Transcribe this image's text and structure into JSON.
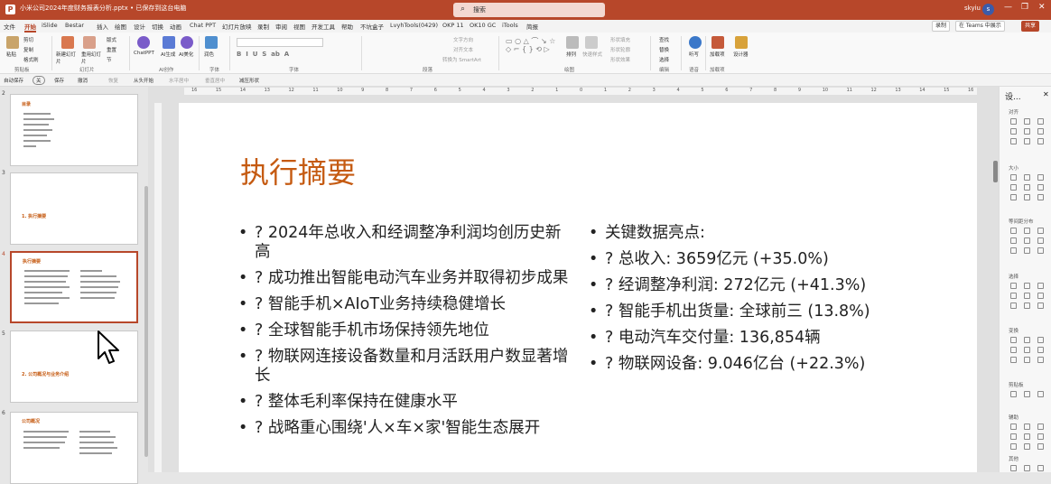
{
  "window": {
    "document_title": "小米公司2024年度财务报表分析.pptx • 已保存到这台电脑",
    "app_icon": "P",
    "search_placeholder": "搜索",
    "user_name": "skyiu",
    "avatar_letter": "s",
    "controls": [
      "—",
      "❐",
      "✕"
    ]
  },
  "tabs": {
    "items": [
      "文件",
      "开始",
      "iSlide",
      "Bestar",
      "插入",
      "绘图",
      "设计",
      "切换",
      "动画",
      "Chat PPT",
      "幻灯片放映",
      "录制",
      "审阅",
      "视图",
      "开发工具",
      "帮助",
      "不坑盒子",
      "LvyhTools(0429)",
      "OKP 11",
      "OK10 GC",
      "iTools",
      "简报"
    ],
    "active_index": 1,
    "record_label": "录制",
    "teams_label": "在 Teams 中展示",
    "share_label": "共享"
  },
  "ribbon": {
    "groups": [
      "剪贴板",
      "幻灯片",
      "AI创作",
      "字体",
      "段落",
      "绘图",
      "编辑",
      "语音",
      "加载项"
    ],
    "buttons": [
      "粘贴",
      "新建幻灯片",
      "重用幻灯片",
      "ChatPPT",
      "AI生成",
      "AI美化",
      "润色"
    ],
    "small_buttons": [
      "剪切",
      "复制",
      "格式刷",
      "版式",
      "重置",
      "节",
      "文字方向",
      "对齐文本",
      "转换为 SmartArt",
      "排列",
      "快速样式",
      "形状填充",
      "形状轮廓",
      "形状效果",
      "查找",
      "替换",
      "选择",
      "听写",
      "加载项",
      "设计器"
    ]
  },
  "qat": {
    "items": [
      "自动保存",
      "关",
      "保存",
      "撤消",
      "恢复",
      "从头开始",
      "水平居中",
      "垂直居中",
      "减压形状"
    ]
  },
  "thumbnails": [
    {
      "number": "2",
      "title": "目录",
      "selected": false
    },
    {
      "number": "3",
      "title": "1. 执行摘要",
      "selected": false
    },
    {
      "number": "4",
      "title": "执行摘要",
      "selected": true
    },
    {
      "number": "5",
      "title": "2. 公司概况与业务介绍",
      "selected": false
    },
    {
      "number": "6",
      "title": "公司概况",
      "selected": false
    }
  ],
  "ruler_ticks": [
    "16",
    "15",
    "14",
    "13",
    "12",
    "11",
    "10",
    "9",
    "8",
    "7",
    "6",
    "5",
    "4",
    "3",
    "2",
    "1",
    "0",
    "1",
    "2",
    "3",
    "4",
    "5",
    "6",
    "7",
    "8",
    "9",
    "10",
    "11",
    "12",
    "13",
    "14",
    "15",
    "16"
  ],
  "slide": {
    "title": "执行摘要",
    "left_bullets": [
      "? 2024年总收入和经调整净利润均创历史新高",
      "? 成功推出智能电动汽车业务并取得初步成果",
      "? 智能手机×AIoT业务持续稳健增长",
      "? 全球智能手机市场保持领先地位",
      "? 物联网连接设备数量和月活跃用户数显著增长",
      "? 整体毛利率保持在健康水平",
      "? 战略重心围绕'人×车×家'智能生态展开"
    ],
    "right_bullets": [
      "关键数据亮点:",
      "? 总收入: 3659亿元 (+35.0%)",
      "? 经调整净利润: 272亿元 (+41.3%)",
      "? 智能手机出货量: 全球前三 (13.8%)",
      "? 电动汽车交付量: 136,854辆",
      "? 物联网设备: 9.046亿台 (+22.3%)"
    ]
  },
  "pane": {
    "title": "设...",
    "sections": [
      "对齐",
      "大小",
      "等间距分布",
      "选择",
      "变换",
      "剪贴板",
      "辅助",
      "其他"
    ]
  },
  "colors": {
    "accent": "#b7472a",
    "title_orange": "#c55a11"
  }
}
